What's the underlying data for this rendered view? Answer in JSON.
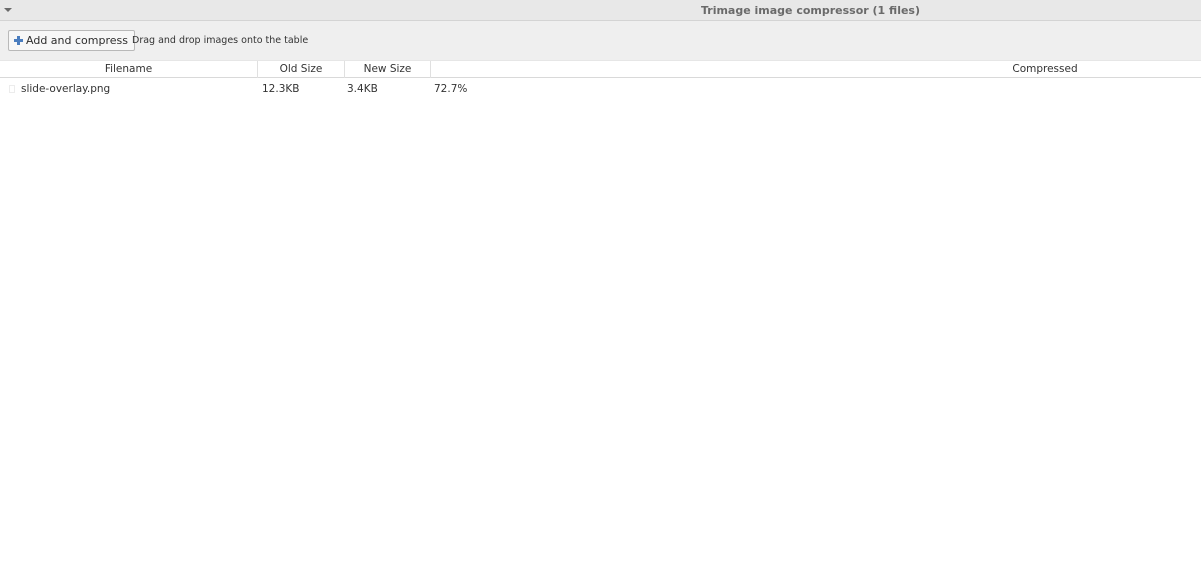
{
  "window": {
    "title": "Trimage image compressor (1 files)"
  },
  "toolbar": {
    "add_button_label": "Add and compress",
    "hint": "Drag and drop images onto the table"
  },
  "table": {
    "columns": [
      "Filename",
      "Old Size",
      "New Size",
      "Compressed"
    ],
    "rows": [
      {
        "filename": "slide-overlay.png",
        "old_size": "12.3KB",
        "new_size": "3.4KB",
        "compressed": "72.7%"
      }
    ]
  },
  "icons": {
    "titlebar_menu": "chevron-down-icon",
    "add_button": "plus-icon",
    "file": "file-icon"
  },
  "colors": {
    "accent": "#4a7dbf",
    "titlebar_bg": "#e8e8e8",
    "toolbar_bg": "#efefef"
  }
}
